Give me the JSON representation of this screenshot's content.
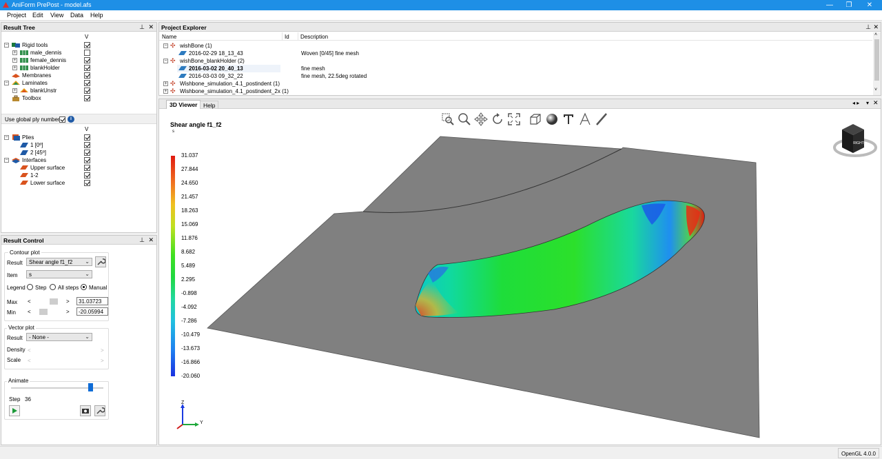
{
  "window": {
    "title": "AniForm PrePost - model.afs",
    "minimize": "—",
    "maximize": "❐",
    "close": "✕"
  },
  "menu": [
    "Project",
    "Edit",
    "View",
    "Data",
    "Help"
  ],
  "result_tree": {
    "title": "Result Tree",
    "col_v": "V",
    "items": [
      {
        "label": "Rigid tools",
        "checked": true
      },
      {
        "label": "male_dennis",
        "checked": false
      },
      {
        "label": "female_dennis",
        "checked": true
      },
      {
        "label": "blankHolder",
        "checked": true
      },
      {
        "label": "Membranes",
        "checked": true
      },
      {
        "label": "Laminates",
        "checked": true
      },
      {
        "label": "blankUnstr",
        "checked": true
      },
      {
        "label": "Toolbox",
        "checked": true
      }
    ],
    "global_ply_label": "Use global ply numbers",
    "col_v2": "V",
    "plies": [
      {
        "label": "Plies",
        "checked": true
      },
      {
        "label": "1 [0º]",
        "checked": true
      },
      {
        "label": "2 [45º]",
        "checked": true
      },
      {
        "label": "Interfaces",
        "checked": true
      },
      {
        "label": "Upper surface",
        "checked": true
      },
      {
        "label": "1-2",
        "checked": true
      },
      {
        "label": "Lower surface",
        "checked": true
      }
    ]
  },
  "result_control": {
    "title": "Result Control",
    "contour_group": "Contour plot",
    "result_label": "Result",
    "result_value": "Shear angle f1_f2",
    "item_label": "Item",
    "item_value": "s",
    "legend_label": "Legend",
    "legend_step": "Step",
    "legend_all": "All steps",
    "legend_manual": "Manual",
    "max_label": "Max",
    "max_value": "31.03723",
    "min_label": "Min",
    "min_value": "-20.05994",
    "vector_group": "Vector plot",
    "vector_result_label": "Result",
    "vector_result_value": "- None -",
    "density_label": "Density",
    "scale_label": "Scale",
    "animate_group": "Animate",
    "step_label": "Step",
    "step_value": "36",
    "animate_position": 0.85
  },
  "project_explorer": {
    "title": "Project Explorer",
    "col_name": "Name",
    "col_id": "Id",
    "col_desc": "Description",
    "rows": [
      {
        "name": "wishBone (1)",
        "desc": ""
      },
      {
        "name": "2016-02-29 18_13_43",
        "desc": "Woven [0/45] fine mesh"
      },
      {
        "name": "wishBone_blankHolder (2)",
        "desc": ""
      },
      {
        "name": "2016-03-02 20_40_13",
        "desc": "fine mesh"
      },
      {
        "name": "2016-03-03 09_32_22",
        "desc": "fine mesh, 22.5deg rotated"
      },
      {
        "name": "Wishbone_simulation_4.1_postindent (1)",
        "desc": ""
      },
      {
        "name": "Wishbone_simulation_4.1_postindent_2x (1)",
        "desc": ""
      }
    ]
  },
  "viewer": {
    "tab_active": "3D Viewer",
    "tab_help": "Help",
    "plot_title": "Shear angle f1_f2",
    "plot_sub": "s",
    "cube_label": "RIGHT",
    "axis_z": "Z",
    "axis_y": "Y",
    "scale_values": [
      "31.037",
      "27.844",
      "24.650",
      "21.457",
      "18.263",
      "15.069",
      "11.876",
      "8.682",
      "5.489",
      "2.295",
      "-0.898",
      "-4.092",
      "-7.286",
      "-10.479",
      "-13.673",
      "-16.866",
      "-20.060"
    ],
    "toolbar_icons": [
      "zoom-box-icon",
      "zoom-icon",
      "pan-icon",
      "rotate-icon",
      "fit-icon",
      "box-icon",
      "sphere-icon",
      "text-icon",
      "font-outline-icon",
      "measure-icon"
    ]
  },
  "status": {
    "opengl": "OpenGL 4.0.0"
  },
  "colors": {
    "titlebar": "#1e8fe6",
    "surface": "#808080"
  }
}
